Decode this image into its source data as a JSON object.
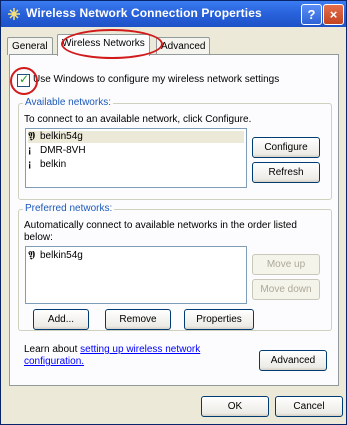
{
  "window": {
    "title": "Wireless Network Connection Properties",
    "help_label": "?",
    "close_label": "×"
  },
  "tabs": [
    {
      "label": "General"
    },
    {
      "label": "Wireless Networks"
    },
    {
      "label": "Advanced"
    }
  ],
  "checkbox": {
    "label": "Use Windows to configure my wireless network settings",
    "checked": true
  },
  "available": {
    "legend": "Available networks:",
    "description": "To connect to an available network, click Configure.",
    "networks": [
      {
        "name": "belkin54g",
        "icon": "wireless-antenna-icon"
      },
      {
        "name": "DMR-8VH",
        "icon": "antenna-icon"
      },
      {
        "name": "belkin",
        "icon": "antenna-icon"
      }
    ],
    "configure_label": "Configure",
    "refresh_label": "Refresh"
  },
  "preferred": {
    "legend": "Preferred networks:",
    "description_line1": "Automatically connect to available networks in the order listed",
    "description_line2": "below:",
    "networks": [
      {
        "name": "belkin54g",
        "icon": "wireless-antenna-icon"
      }
    ],
    "move_up_label": "Move up",
    "move_down_label": "Move down",
    "add_label": "Add...",
    "remove_label": "Remove",
    "properties_label": "Properties"
  },
  "learn": {
    "prefix": "Learn about ",
    "link_line1": "setting up wireless network",
    "link_line2": "configuration."
  },
  "advanced_label": "Advanced",
  "ok_label": "OK",
  "cancel_label": "Cancel",
  "colors": {
    "title_bar": "#2a63dc",
    "highlight_circle": "#d11b1b",
    "link": "#0000ff"
  }
}
